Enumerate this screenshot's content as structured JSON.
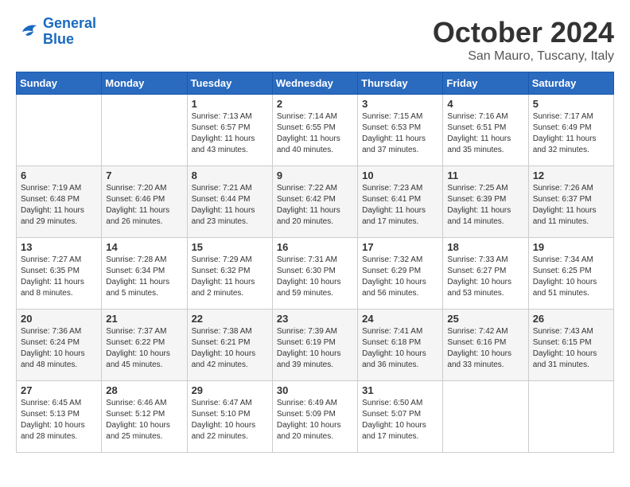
{
  "header": {
    "logo_line1": "General",
    "logo_line2": "Blue",
    "month_title": "October 2024",
    "subtitle": "San Mauro, Tuscany, Italy"
  },
  "weekdays": [
    "Sunday",
    "Monday",
    "Tuesday",
    "Wednesday",
    "Thursday",
    "Friday",
    "Saturday"
  ],
  "weeks": [
    [
      null,
      null,
      {
        "day": "1",
        "sunrise": "7:13 AM",
        "sunset": "6:57 PM",
        "daylight": "11 hours and 43 minutes."
      },
      {
        "day": "2",
        "sunrise": "7:14 AM",
        "sunset": "6:55 PM",
        "daylight": "11 hours and 40 minutes."
      },
      {
        "day": "3",
        "sunrise": "7:15 AM",
        "sunset": "6:53 PM",
        "daylight": "11 hours and 37 minutes."
      },
      {
        "day": "4",
        "sunrise": "7:16 AM",
        "sunset": "6:51 PM",
        "daylight": "11 hours and 35 minutes."
      },
      {
        "day": "5",
        "sunrise": "7:17 AM",
        "sunset": "6:49 PM",
        "daylight": "11 hours and 32 minutes."
      }
    ],
    [
      {
        "day": "6",
        "sunrise": "7:19 AM",
        "sunset": "6:48 PM",
        "daylight": "11 hours and 29 minutes."
      },
      {
        "day": "7",
        "sunrise": "7:20 AM",
        "sunset": "6:46 PM",
        "daylight": "11 hours and 26 minutes."
      },
      {
        "day": "8",
        "sunrise": "7:21 AM",
        "sunset": "6:44 PM",
        "daylight": "11 hours and 23 minutes."
      },
      {
        "day": "9",
        "sunrise": "7:22 AM",
        "sunset": "6:42 PM",
        "daylight": "11 hours and 20 minutes."
      },
      {
        "day": "10",
        "sunrise": "7:23 AM",
        "sunset": "6:41 PM",
        "daylight": "11 hours and 17 minutes."
      },
      {
        "day": "11",
        "sunrise": "7:25 AM",
        "sunset": "6:39 PM",
        "daylight": "11 hours and 14 minutes."
      },
      {
        "day": "12",
        "sunrise": "7:26 AM",
        "sunset": "6:37 PM",
        "daylight": "11 hours and 11 minutes."
      }
    ],
    [
      {
        "day": "13",
        "sunrise": "7:27 AM",
        "sunset": "6:35 PM",
        "daylight": "11 hours and 8 minutes."
      },
      {
        "day": "14",
        "sunrise": "7:28 AM",
        "sunset": "6:34 PM",
        "daylight": "11 hours and 5 minutes."
      },
      {
        "day": "15",
        "sunrise": "7:29 AM",
        "sunset": "6:32 PM",
        "daylight": "11 hours and 2 minutes."
      },
      {
        "day": "16",
        "sunrise": "7:31 AM",
        "sunset": "6:30 PM",
        "daylight": "10 hours and 59 minutes."
      },
      {
        "day": "17",
        "sunrise": "7:32 AM",
        "sunset": "6:29 PM",
        "daylight": "10 hours and 56 minutes."
      },
      {
        "day": "18",
        "sunrise": "7:33 AM",
        "sunset": "6:27 PM",
        "daylight": "10 hours and 53 minutes."
      },
      {
        "day": "19",
        "sunrise": "7:34 AM",
        "sunset": "6:25 PM",
        "daylight": "10 hours and 51 minutes."
      }
    ],
    [
      {
        "day": "20",
        "sunrise": "7:36 AM",
        "sunset": "6:24 PM",
        "daylight": "10 hours and 48 minutes."
      },
      {
        "day": "21",
        "sunrise": "7:37 AM",
        "sunset": "6:22 PM",
        "daylight": "10 hours and 45 minutes."
      },
      {
        "day": "22",
        "sunrise": "7:38 AM",
        "sunset": "6:21 PM",
        "daylight": "10 hours and 42 minutes."
      },
      {
        "day": "23",
        "sunrise": "7:39 AM",
        "sunset": "6:19 PM",
        "daylight": "10 hours and 39 minutes."
      },
      {
        "day": "24",
        "sunrise": "7:41 AM",
        "sunset": "6:18 PM",
        "daylight": "10 hours and 36 minutes."
      },
      {
        "day": "25",
        "sunrise": "7:42 AM",
        "sunset": "6:16 PM",
        "daylight": "10 hours and 33 minutes."
      },
      {
        "day": "26",
        "sunrise": "7:43 AM",
        "sunset": "6:15 PM",
        "daylight": "10 hours and 31 minutes."
      }
    ],
    [
      {
        "day": "27",
        "sunrise": "6:45 AM",
        "sunset": "5:13 PM",
        "daylight": "10 hours and 28 minutes."
      },
      {
        "day": "28",
        "sunrise": "6:46 AM",
        "sunset": "5:12 PM",
        "daylight": "10 hours and 25 minutes."
      },
      {
        "day": "29",
        "sunrise": "6:47 AM",
        "sunset": "5:10 PM",
        "daylight": "10 hours and 22 minutes."
      },
      {
        "day": "30",
        "sunrise": "6:49 AM",
        "sunset": "5:09 PM",
        "daylight": "10 hours and 20 minutes."
      },
      {
        "day": "31",
        "sunrise": "6:50 AM",
        "sunset": "5:07 PM",
        "daylight": "10 hours and 17 minutes."
      },
      null,
      null
    ]
  ]
}
